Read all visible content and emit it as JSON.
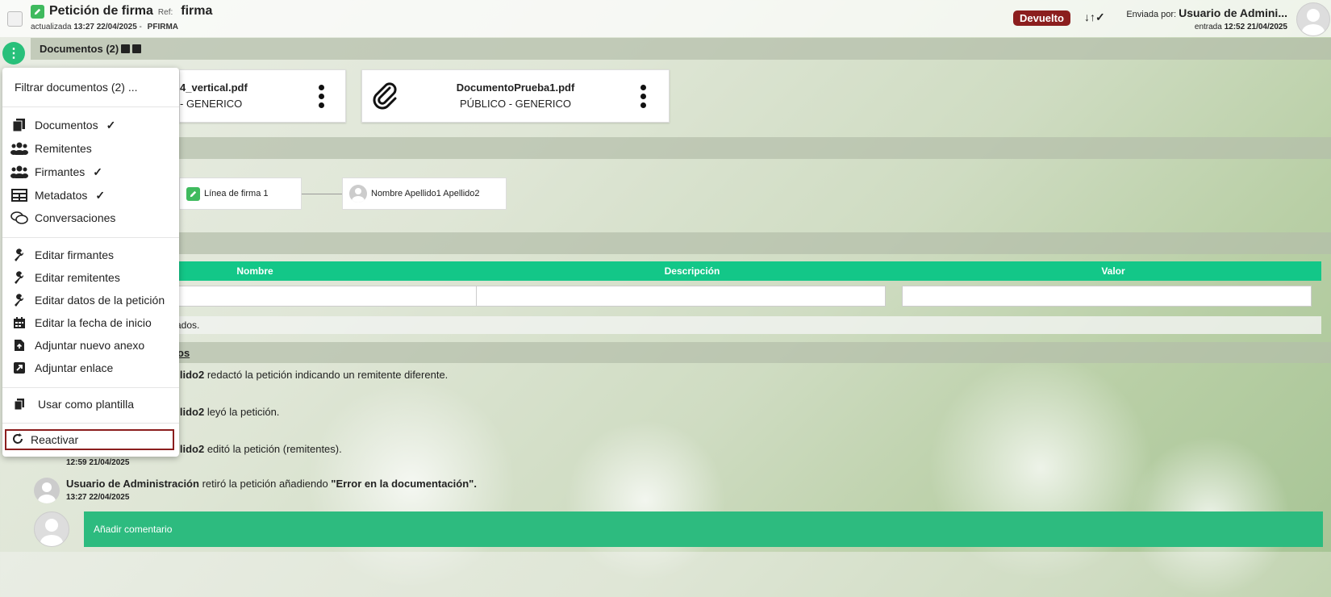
{
  "header": {
    "title": "Petición de firma",
    "ref_label": "Ref:",
    "ref_value": "firma",
    "updated_label": "actualizada",
    "updated_value": "13:27 22/04/2025",
    "app_code": "PFIRMA",
    "status": "Devuelto",
    "sent_by_label": "Enviada por:",
    "sent_by_name": "Usuario de Admini...",
    "entry_label": "entrada",
    "entry_value": "12:52 21/04/2025"
  },
  "documents": {
    "section_title": "Documentos (2)",
    "cards": [
      {
        "name": "4_vertical.pdf",
        "type": "- GENERICO"
      },
      {
        "name": "DocumentoPrueba1.pdf",
        "type": "PÚBLICO - GENERICO"
      }
    ]
  },
  "signers": {
    "line_label": "Línea de firma 1",
    "signer_name": "Nombre Apellido1 Apellido2"
  },
  "metadata": {
    "columns": [
      "Nombre",
      "Descripción",
      "Valor"
    ],
    "empty_text": "ados."
  },
  "history": {
    "link_fragment": "os",
    "items": [
      {
        "name": "ellido2",
        "text": "redactó la petición indicando un remitente diferente.",
        "date": ""
      },
      {
        "name": "ellido2",
        "text": "leyó la petición.",
        "date": ""
      },
      {
        "name": "ellido2",
        "text": "editó la petición (remitentes).",
        "date": "12:59 21/04/2025"
      },
      {
        "name": "Usuario de Administración",
        "text": "retiró la petición añadiendo",
        "quote": "\"Error en la documentación\".",
        "date": "13:27 22/04/2025"
      }
    ],
    "comment_placeholder": "Añadir comentario"
  },
  "menu": {
    "filter": "Filtrar documentos (2) ...",
    "view_items": [
      {
        "label": "Documentos",
        "checked": true,
        "icon": "copy-icon"
      },
      {
        "label": "Remitentes",
        "checked": false,
        "icon": "users-icon"
      },
      {
        "label": "Firmantes",
        "checked": true,
        "icon": "users-icon"
      },
      {
        "label": "Metadatos",
        "checked": true,
        "icon": "table-icon"
      },
      {
        "label": "Conversaciones",
        "checked": false,
        "icon": "comments-icon"
      }
    ],
    "edit_items": [
      {
        "label": "Editar firmantes",
        "icon": "wrench-icon"
      },
      {
        "label": "Editar remitentes",
        "icon": "wrench-icon"
      },
      {
        "label": "Editar datos de la petición",
        "icon": "wrench-icon"
      },
      {
        "label": "Editar la fecha de inicio",
        "icon": "calendar-icon"
      },
      {
        "label": "Adjuntar nuevo anexo",
        "icon": "file-upload-icon"
      },
      {
        "label": "Adjuntar enlace",
        "icon": "external-link-icon"
      }
    ],
    "template_item": "Usar como plantilla",
    "reactivate_item": "Reactivar"
  },
  "colors": {
    "accent": "#13c788",
    "status": "#8b1e1e"
  }
}
